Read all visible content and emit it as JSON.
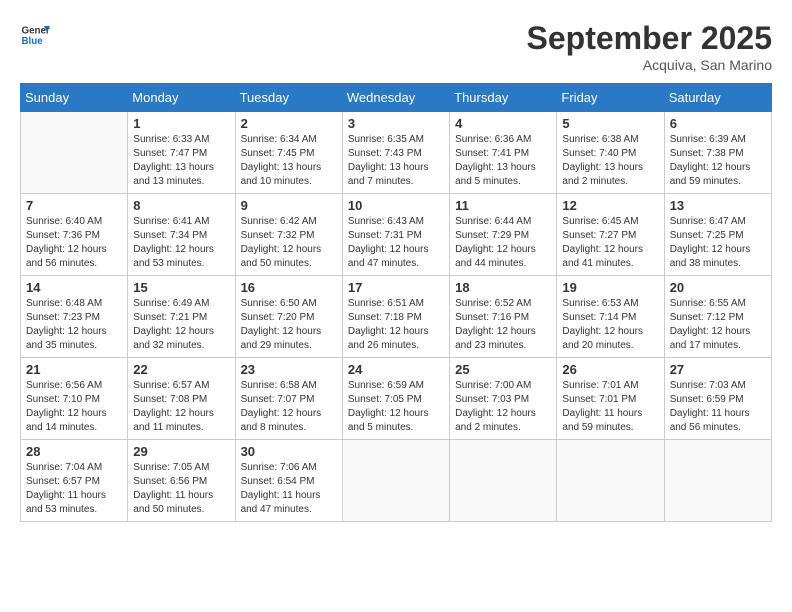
{
  "header": {
    "logo_line1": "General",
    "logo_line2": "Blue",
    "month": "September 2025",
    "location": "Acquiva, San Marino"
  },
  "days_of_week": [
    "Sunday",
    "Monday",
    "Tuesday",
    "Wednesday",
    "Thursday",
    "Friday",
    "Saturday"
  ],
  "weeks": [
    [
      {
        "day": "",
        "info": ""
      },
      {
        "day": "1",
        "info": "Sunrise: 6:33 AM\nSunset: 7:47 PM\nDaylight: 13 hours\nand 13 minutes."
      },
      {
        "day": "2",
        "info": "Sunrise: 6:34 AM\nSunset: 7:45 PM\nDaylight: 13 hours\nand 10 minutes."
      },
      {
        "day": "3",
        "info": "Sunrise: 6:35 AM\nSunset: 7:43 PM\nDaylight: 13 hours\nand 7 minutes."
      },
      {
        "day": "4",
        "info": "Sunrise: 6:36 AM\nSunset: 7:41 PM\nDaylight: 13 hours\nand 5 minutes."
      },
      {
        "day": "5",
        "info": "Sunrise: 6:38 AM\nSunset: 7:40 PM\nDaylight: 13 hours\nand 2 minutes."
      },
      {
        "day": "6",
        "info": "Sunrise: 6:39 AM\nSunset: 7:38 PM\nDaylight: 12 hours\nand 59 minutes."
      }
    ],
    [
      {
        "day": "7",
        "info": "Sunrise: 6:40 AM\nSunset: 7:36 PM\nDaylight: 12 hours\nand 56 minutes."
      },
      {
        "day": "8",
        "info": "Sunrise: 6:41 AM\nSunset: 7:34 PM\nDaylight: 12 hours\nand 53 minutes."
      },
      {
        "day": "9",
        "info": "Sunrise: 6:42 AM\nSunset: 7:32 PM\nDaylight: 12 hours\nand 50 minutes."
      },
      {
        "day": "10",
        "info": "Sunrise: 6:43 AM\nSunset: 7:31 PM\nDaylight: 12 hours\nand 47 minutes."
      },
      {
        "day": "11",
        "info": "Sunrise: 6:44 AM\nSunset: 7:29 PM\nDaylight: 12 hours\nand 44 minutes."
      },
      {
        "day": "12",
        "info": "Sunrise: 6:45 AM\nSunset: 7:27 PM\nDaylight: 12 hours\nand 41 minutes."
      },
      {
        "day": "13",
        "info": "Sunrise: 6:47 AM\nSunset: 7:25 PM\nDaylight: 12 hours\nand 38 minutes."
      }
    ],
    [
      {
        "day": "14",
        "info": "Sunrise: 6:48 AM\nSunset: 7:23 PM\nDaylight: 12 hours\nand 35 minutes."
      },
      {
        "day": "15",
        "info": "Sunrise: 6:49 AM\nSunset: 7:21 PM\nDaylight: 12 hours\nand 32 minutes."
      },
      {
        "day": "16",
        "info": "Sunrise: 6:50 AM\nSunset: 7:20 PM\nDaylight: 12 hours\nand 29 minutes."
      },
      {
        "day": "17",
        "info": "Sunrise: 6:51 AM\nSunset: 7:18 PM\nDaylight: 12 hours\nand 26 minutes."
      },
      {
        "day": "18",
        "info": "Sunrise: 6:52 AM\nSunset: 7:16 PM\nDaylight: 12 hours\nand 23 minutes."
      },
      {
        "day": "19",
        "info": "Sunrise: 6:53 AM\nSunset: 7:14 PM\nDaylight: 12 hours\nand 20 minutes."
      },
      {
        "day": "20",
        "info": "Sunrise: 6:55 AM\nSunset: 7:12 PM\nDaylight: 12 hours\nand 17 minutes."
      }
    ],
    [
      {
        "day": "21",
        "info": "Sunrise: 6:56 AM\nSunset: 7:10 PM\nDaylight: 12 hours\nand 14 minutes."
      },
      {
        "day": "22",
        "info": "Sunrise: 6:57 AM\nSunset: 7:08 PM\nDaylight: 12 hours\nand 11 minutes."
      },
      {
        "day": "23",
        "info": "Sunrise: 6:58 AM\nSunset: 7:07 PM\nDaylight: 12 hours\nand 8 minutes."
      },
      {
        "day": "24",
        "info": "Sunrise: 6:59 AM\nSunset: 7:05 PM\nDaylight: 12 hours\nand 5 minutes."
      },
      {
        "day": "25",
        "info": "Sunrise: 7:00 AM\nSunset: 7:03 PM\nDaylight: 12 hours\nand 2 minutes."
      },
      {
        "day": "26",
        "info": "Sunrise: 7:01 AM\nSunset: 7:01 PM\nDaylight: 11 hours\nand 59 minutes."
      },
      {
        "day": "27",
        "info": "Sunrise: 7:03 AM\nSunset: 6:59 PM\nDaylight: 11 hours\nand 56 minutes."
      }
    ],
    [
      {
        "day": "28",
        "info": "Sunrise: 7:04 AM\nSunset: 6:57 PM\nDaylight: 11 hours\nand 53 minutes."
      },
      {
        "day": "29",
        "info": "Sunrise: 7:05 AM\nSunset: 6:56 PM\nDaylight: 11 hours\nand 50 minutes."
      },
      {
        "day": "30",
        "info": "Sunrise: 7:06 AM\nSunset: 6:54 PM\nDaylight: 11 hours\nand 47 minutes."
      },
      {
        "day": "",
        "info": ""
      },
      {
        "day": "",
        "info": ""
      },
      {
        "day": "",
        "info": ""
      },
      {
        "day": "",
        "info": ""
      }
    ]
  ]
}
